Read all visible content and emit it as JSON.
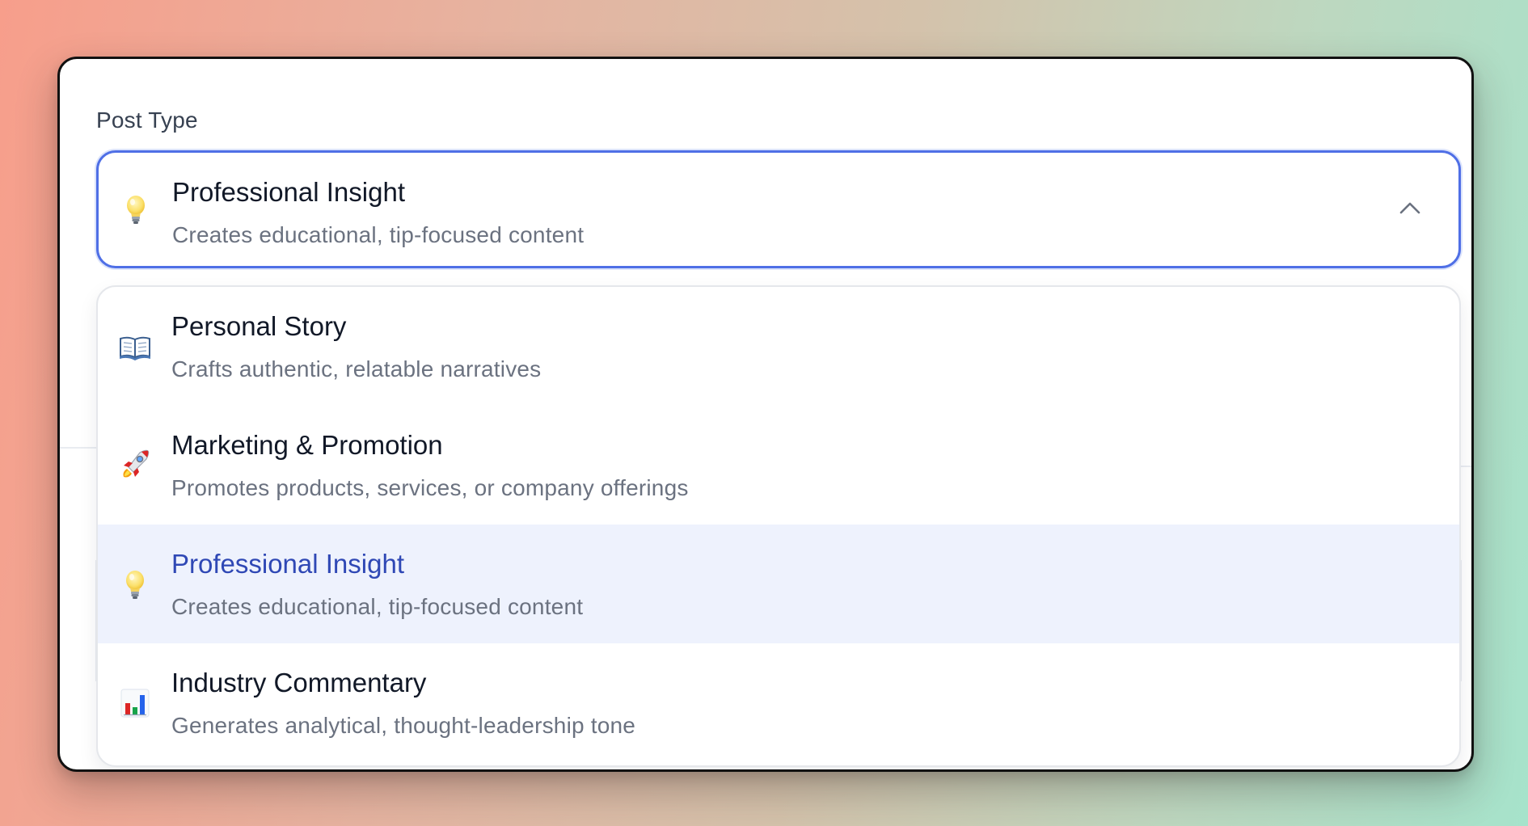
{
  "form": {
    "field_label": "Post Type",
    "selected": {
      "icon": "lightbulb-icon",
      "title": "Professional Insight",
      "description": "Creates educational, tip-focused content"
    },
    "dropdown_state": "open",
    "options": [
      {
        "icon": "open-book-icon",
        "title": "Personal Story",
        "description": "Crafts authentic, relatable narratives",
        "highlighted": false
      },
      {
        "icon": "rocket-icon",
        "title": "Marketing & Promotion",
        "description": "Promotes products, services, or company offerings",
        "highlighted": false
      },
      {
        "icon": "lightbulb-icon",
        "title": "Professional Insight",
        "description": "Creates educational, tip-focused content",
        "highlighted": true
      },
      {
        "icon": "bar-chart-icon",
        "title": "Industry Commentary",
        "description": "Generates analytical, thought-leadership tone",
        "highlighted": false
      }
    ]
  },
  "colors": {
    "focus_border": "#4f6fe6",
    "highlight_background": "#eef2fd",
    "highlight_text": "#2f48b5",
    "title_text": "#111827",
    "description_text": "#6b7280"
  }
}
